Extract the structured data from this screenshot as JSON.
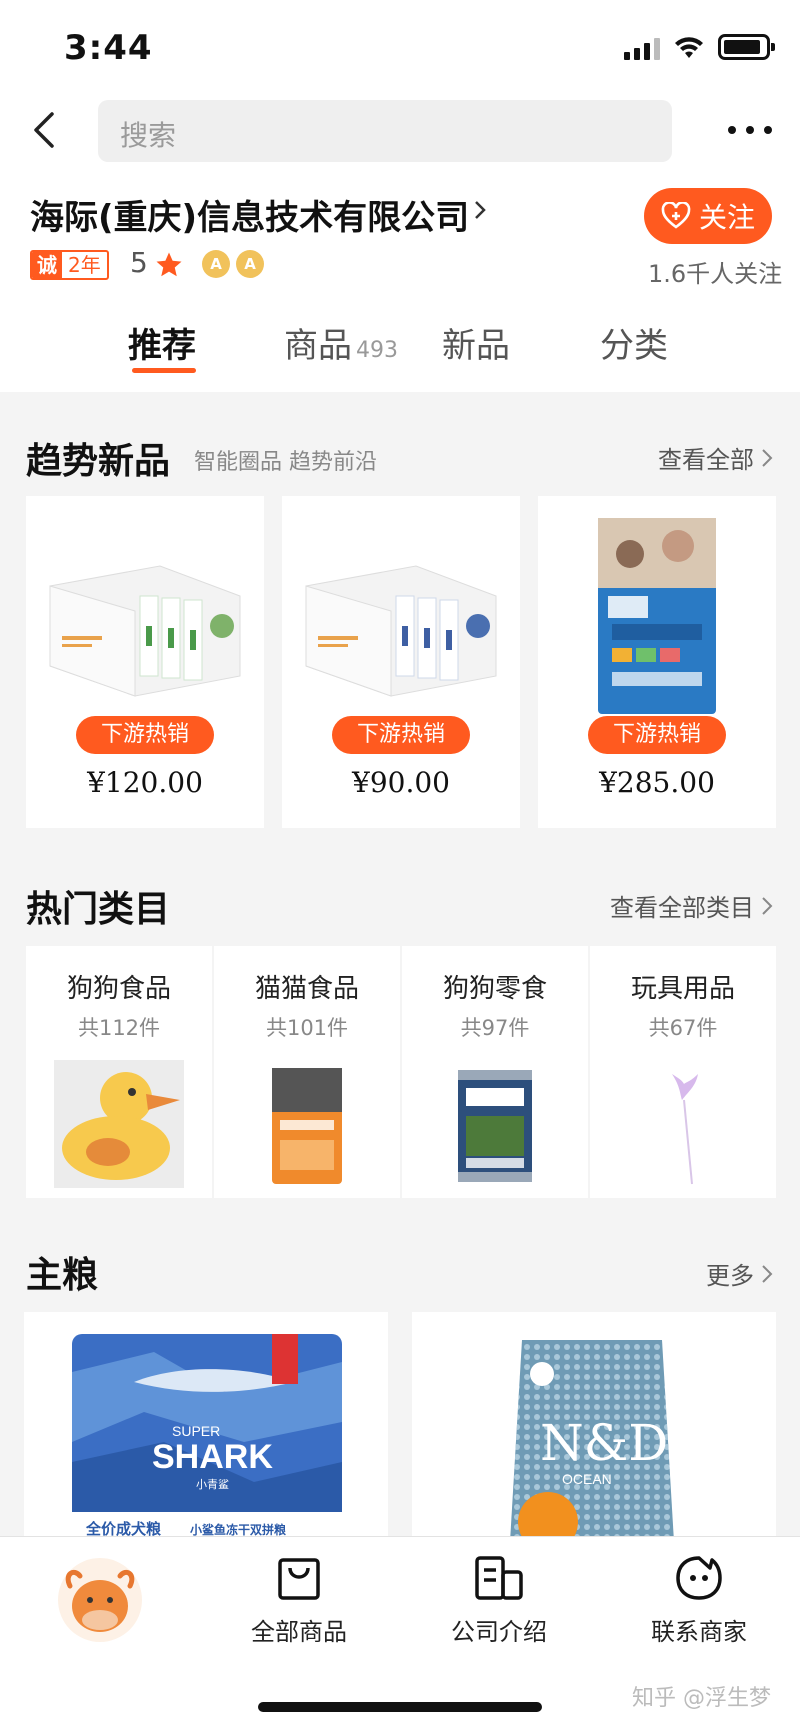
{
  "status": {
    "time": "3:44"
  },
  "search": {
    "placeholder": "搜索"
  },
  "shop": {
    "name": "海际(重庆)信息技术有限公司",
    "badge_prefix": "诚",
    "badge_years": "2年",
    "rating": "5",
    "level_badges": [
      "A",
      "A"
    ],
    "follow_label": "关注",
    "followers": "1.6千人关注"
  },
  "tabs": [
    {
      "label": "推荐",
      "active": true
    },
    {
      "label": "商品",
      "count": "493"
    },
    {
      "label": "新品"
    },
    {
      "label": "分类"
    }
  ],
  "trending": {
    "title": "趋势新品",
    "subtitle": "智能圈品 趋势前沿",
    "more": "查看全部",
    "items": [
      {
        "badge": "下游热销",
        "price": "¥120.00",
        "image": "gift-box-green"
      },
      {
        "badge": "下游热销",
        "price": "¥90.00",
        "image": "gift-box-blue"
      },
      {
        "badge": "下游热销",
        "price": "¥285.00",
        "image": "cat-food-bag"
      }
    ]
  },
  "categories": {
    "title": "热门类目",
    "more": "查看全部类目",
    "items": [
      {
        "name": "狗狗食品",
        "count": "共112件",
        "image": "duck"
      },
      {
        "name": "猫猫食品",
        "count": "共101件",
        "image": "cat-kitten-bag"
      },
      {
        "name": "狗狗零食",
        "count": "共97件",
        "image": "ziwi-can"
      },
      {
        "name": "玩具用品",
        "count": "共67件",
        "image": "feather-wand"
      }
    ]
  },
  "main_food": {
    "title": "主粮",
    "more": "更多",
    "items": [
      {
        "image": "super-shark-bag",
        "brand": "SUPER",
        "brand2": "SHARK",
        "sub": "小青鲨",
        "caption1": "全价成犬粮",
        "caption2": "小鲨鱼冻干双拼粮"
      },
      {
        "image": "nd-ocean-bag",
        "brand": "N&D",
        "sub": "OCEAN"
      }
    ]
  },
  "bottom_nav": {
    "items": [
      {
        "label": "",
        "icon": "shop-avatar"
      },
      {
        "label": "全部商品",
        "icon": "bag-icon"
      },
      {
        "label": "公司介绍",
        "icon": "company-icon"
      },
      {
        "label": "联系商家",
        "icon": "chat-icon"
      }
    ]
  },
  "watermark": "知乎 @浮生梦",
  "colors": {
    "accent": "#ff5a1f",
    "background": "#f4f4f4"
  }
}
